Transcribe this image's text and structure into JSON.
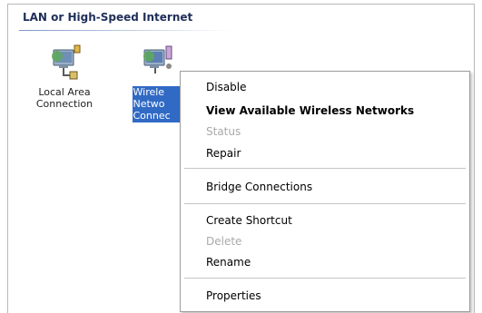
{
  "group": {
    "title": "LAN or High-Speed Internet"
  },
  "connections": [
    {
      "label_line1": "Local Area",
      "label_line2": "Connection",
      "label_line3": ""
    },
    {
      "label_line1": "Wirele",
      "label_line2": "Netwo",
      "label_line3": "Connec"
    }
  ],
  "context_menu": {
    "items": [
      {
        "label": "Disable",
        "style": "normal"
      },
      {
        "label": "View Available Wireless Networks",
        "style": "bold"
      },
      {
        "label": "Status",
        "style": "disabled"
      },
      {
        "label": "Repair",
        "style": "normal"
      },
      {
        "label": "Bridge Connections",
        "style": "normal"
      },
      {
        "label": "Create Shortcut",
        "style": "normal"
      },
      {
        "label": "Delete",
        "style": "disabled"
      },
      {
        "label": "Rename",
        "style": "normal"
      },
      {
        "label": "Properties",
        "style": "normal"
      }
    ]
  },
  "colors": {
    "selection": "#316ac5",
    "header_text": "#1f2f5a",
    "disabled_text": "#a9a9a9"
  }
}
